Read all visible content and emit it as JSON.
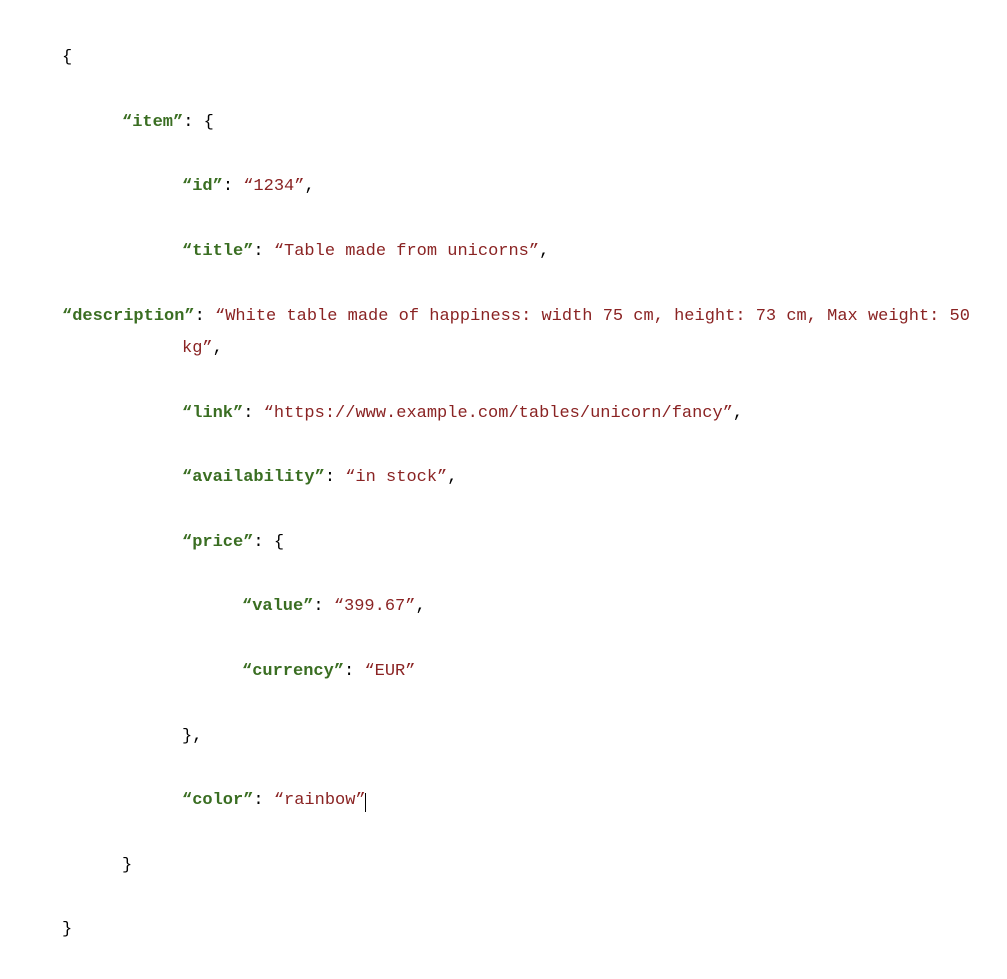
{
  "code": {
    "brace_open": "{",
    "brace_close": "}",
    "colon_brace": ": {",
    "colon_space": ": ",
    "comma": ",",
    "brace_close_comma": "},",
    "quote_open": "“",
    "quote_close": "”",
    "keys": {
      "item": "“item”",
      "id": "“id”",
      "title": "“title”",
      "description": "“description”",
      "link": "“link”",
      "availability": "“availability”",
      "price": "“price”",
      "value": "“value”",
      "currency": "“currency”",
      "color": "“color”"
    },
    "values": {
      "id": "“1234”",
      "title": "“Table made from unicorns”",
      "description": "“White table made of happiness: width 75 cm, height: 73 cm, Max weight: 50 kg”",
      "link": "“https://www.example.com/tables/unicorn/fancy”",
      "availability": "“in stock”",
      "price_value": "“399.67”",
      "currency": "“EUR”",
      "color": "“rainbow”"
    }
  }
}
